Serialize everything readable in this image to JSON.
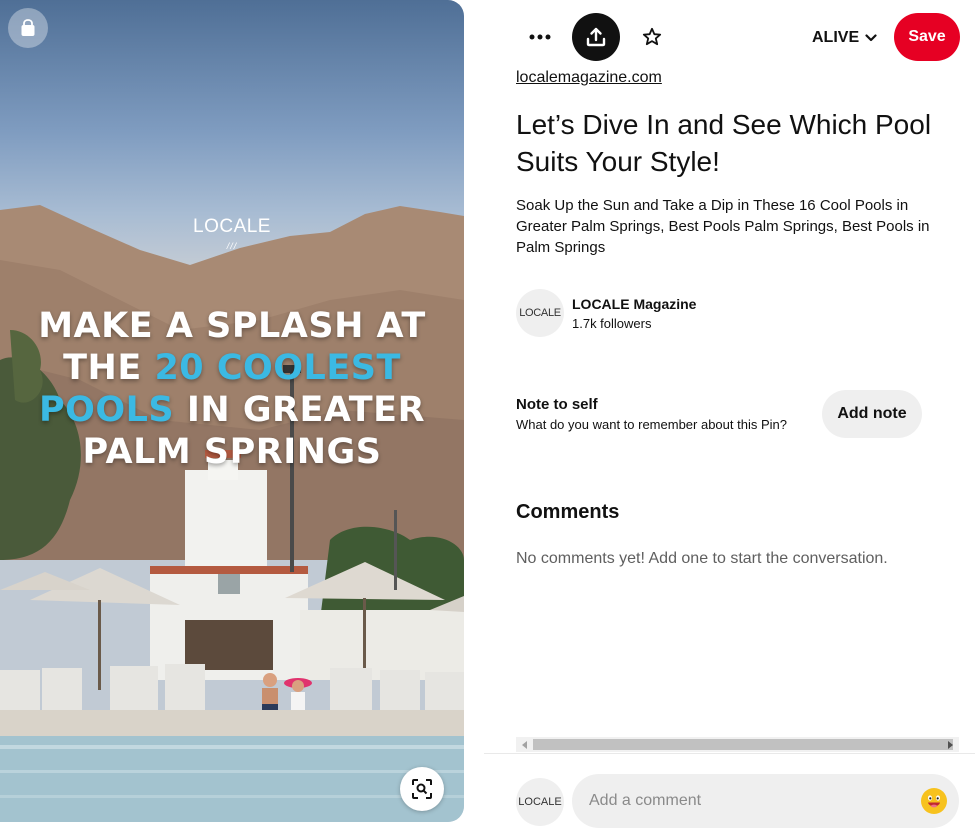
{
  "image": {
    "overlay_brand": "LOCALE",
    "overlay_brand_mark": "///",
    "headline_lines": [
      {
        "before": "MAKE A SPLASH AT",
        "highlight": "",
        "after": ""
      },
      {
        "before": "THE ",
        "highlight": "20 COOLEST",
        "after": ""
      },
      {
        "before": "",
        "highlight": "POOLS",
        "after": " IN GREATER"
      },
      {
        "before": "PALM SPRINGS",
        "highlight": "",
        "after": ""
      }
    ],
    "shop_icon": "shopping-bag-icon",
    "lens_icon": "visual-search-icon"
  },
  "toolbar": {
    "more_icon": "more-dots-icon",
    "share_icon": "share-upload-icon",
    "favorite_icon": "star-icon",
    "board_name": "ALIVE",
    "save_label": "Save"
  },
  "pin": {
    "source": "localemagazine.com",
    "title": "Let’s Dive In and See Which Pool Suits Your Style!",
    "description": "Soak Up the Sun and Take a Dip in These 16 Cool Pools in Greater Palm Springs, Best Pools Palm Springs, Best Pools in Palm Springs"
  },
  "creator": {
    "avatar_text": "LOCALE",
    "name": "LOCALE Magazine",
    "followers": "1.7k followers"
  },
  "note": {
    "title": "Note to self",
    "prompt": "What do you want to remember about this Pin?",
    "button_label": "Add note"
  },
  "comments": {
    "title": "Comments",
    "empty_text": "No comments yet! Add one to start the conversation.",
    "input_placeholder": "Add a comment",
    "avatar_text": "LOCALE",
    "emoji_icon": "emoji-smile-icon"
  },
  "colors": {
    "save_red": "#e60023",
    "headline_blue": "#3bb9e3",
    "button_gray": "#efefef"
  }
}
